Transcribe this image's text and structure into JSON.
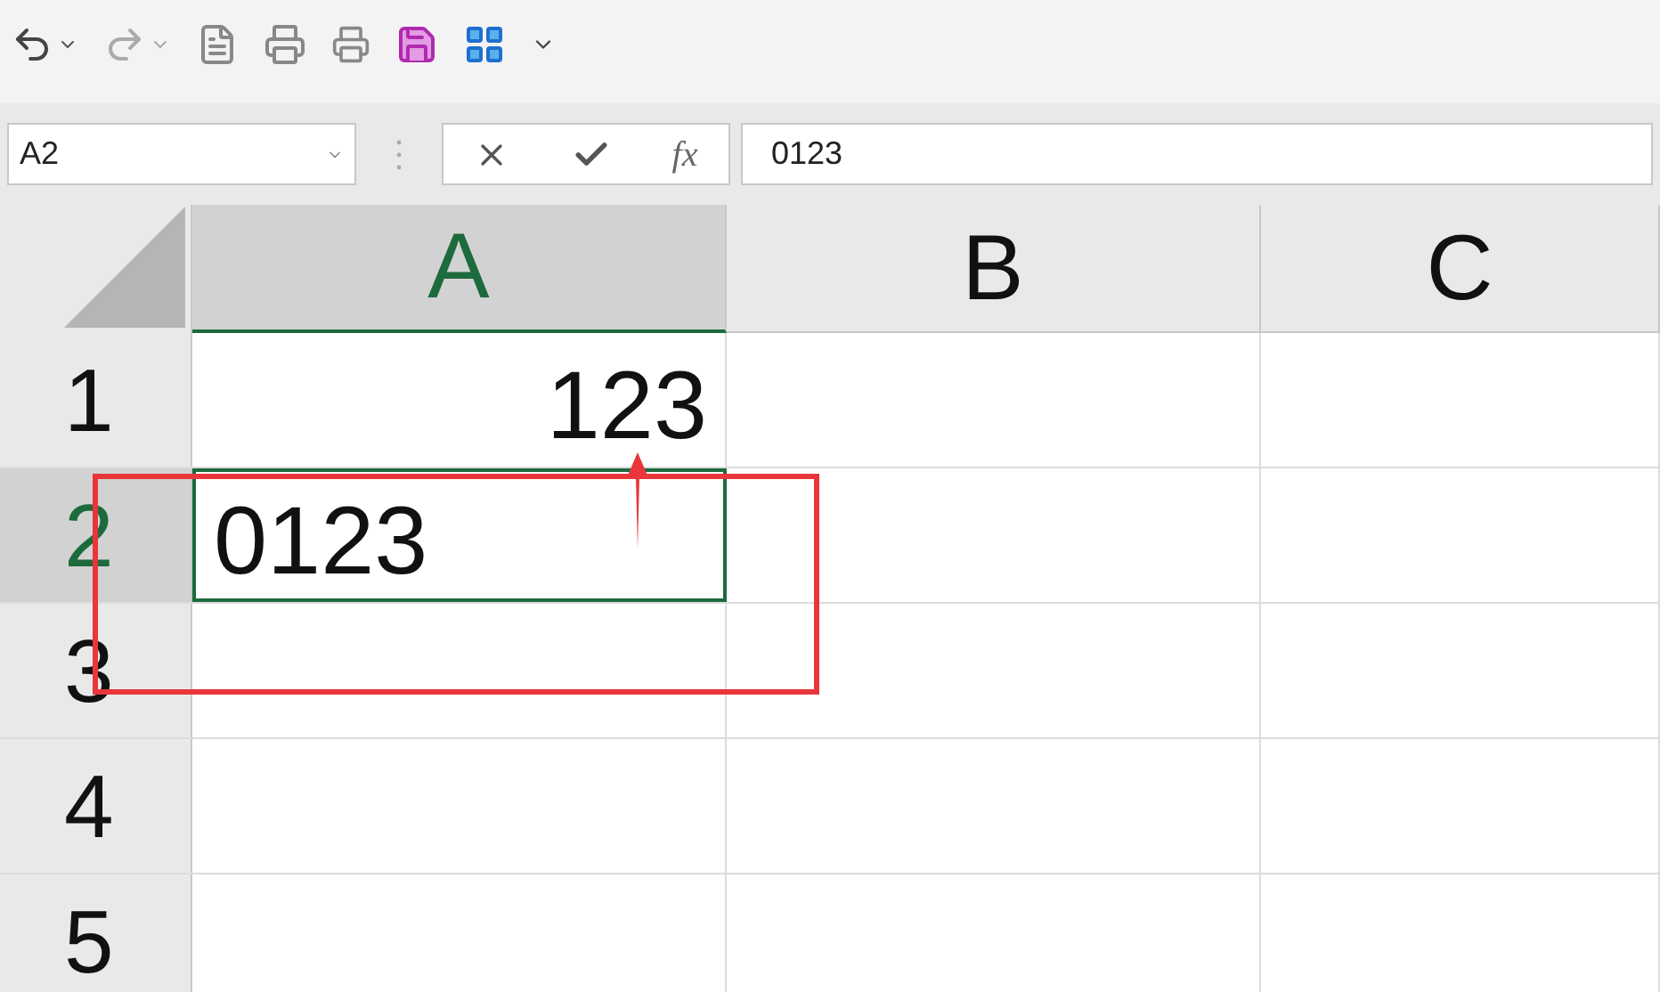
{
  "name_box": {
    "value": "A2"
  },
  "formula_bar": {
    "function_label": "fx",
    "value": "0123"
  },
  "columns": [
    {
      "label": "A",
      "selected": true
    },
    {
      "label": "B",
      "selected": false
    },
    {
      "label": "C",
      "selected": false
    }
  ],
  "rows": [
    {
      "label": "1",
      "selected": false,
      "cell_a": {
        "value": "123",
        "kind": "number",
        "selected": false
      }
    },
    {
      "label": "2",
      "selected": true,
      "cell_a": {
        "value": "0123",
        "kind": "text",
        "selected": true
      }
    },
    {
      "label": "3",
      "selected": false
    },
    {
      "label": "4",
      "selected": false
    },
    {
      "label": "5",
      "selected": false
    }
  ]
}
